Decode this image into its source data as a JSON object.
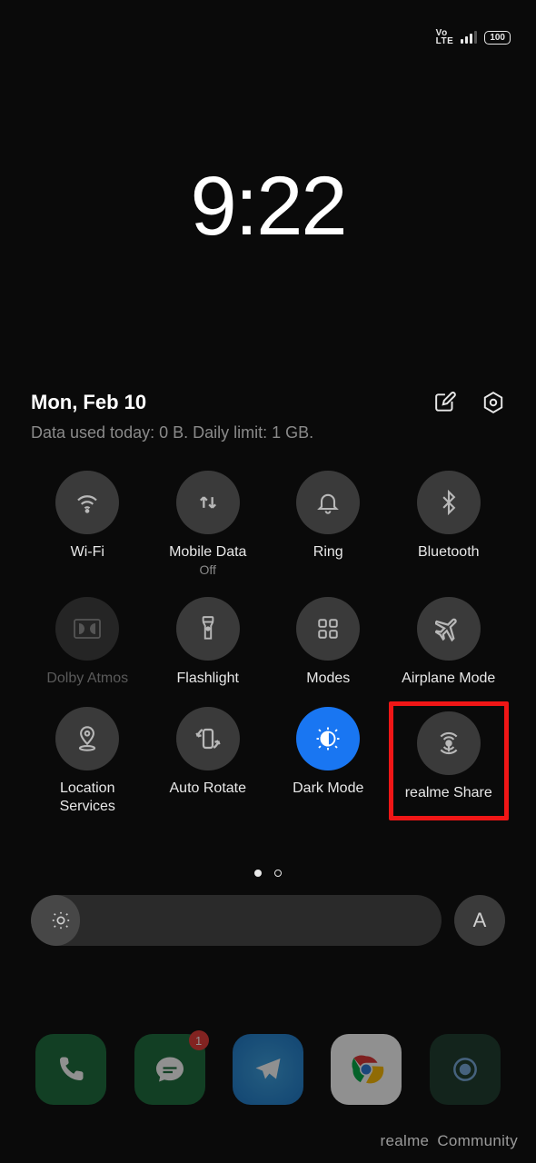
{
  "statusBar": {
    "net": "Vo\nLTE",
    "battery": "100"
  },
  "clock": "9:22",
  "header": {
    "date": "Mon, Feb 10",
    "dataUsage": "Data used today: 0 B. Daily limit: 1 GB."
  },
  "tiles": {
    "wifi": "Wi-Fi",
    "mobileData": "Mobile Data",
    "mobileDataSub": "Off",
    "ring": "Ring",
    "bluetooth": "Bluetooth",
    "dolby": "Dolby Atmos",
    "flashlight": "Flashlight",
    "modes": "Modes",
    "airplane": "Airplane Mode",
    "location": "Location\nServices",
    "autoRotate": "Auto Rotate",
    "darkMode": "Dark Mode",
    "realmeShare": "realme Share"
  },
  "auto": "A",
  "badge1": "1",
  "watermark": {
    "brand": "realme",
    "sub": "Community"
  }
}
